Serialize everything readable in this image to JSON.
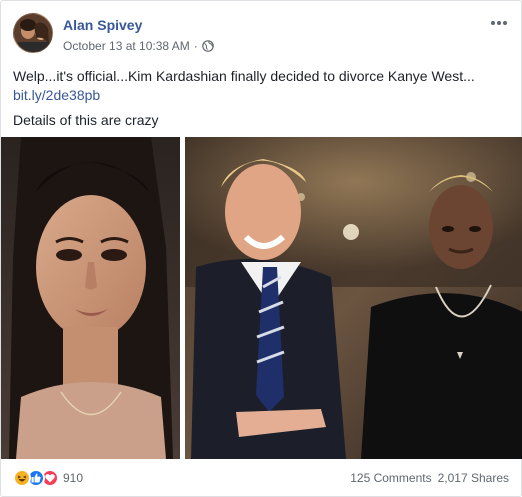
{
  "post": {
    "author": "Alan Spivey",
    "timestamp": "October 13 at 10:38 AM",
    "separator": "·",
    "privacy_icon": "globe-icon",
    "text_line1": "Welp...it's official...Kim Kardashian finally decided to divorce Kanye West...",
    "link": "bit.ly/2de38pb",
    "text_line2": "Details of this are crazy"
  },
  "reactions": {
    "icons": [
      "haha-icon",
      "like-icon",
      "love-icon"
    ],
    "count": "910"
  },
  "stats": {
    "comments": "125 Comments",
    "shares": "2,017 Shares"
  },
  "colors": {
    "link": "#385898",
    "meta": "#616770",
    "like": "#1877f2",
    "love": "#f33e58",
    "haha": "#f7b125"
  }
}
